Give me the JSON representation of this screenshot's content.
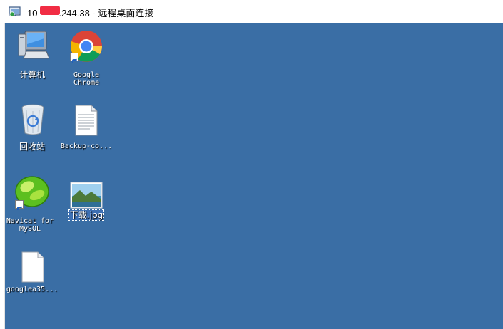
{
  "window": {
    "title_prefix": "10",
    "title_suffix": ".244.38 - 远程桌面连接"
  },
  "desktop": {
    "background": "#3a6ea5",
    "icons": [
      {
        "label": "计算机",
        "icon": "computer-icon"
      },
      {
        "label": "Google\nChrome",
        "icon": "chrome-icon"
      },
      {
        "label": "回收站",
        "icon": "recycle-bin-icon"
      },
      {
        "label": "Backup-co...",
        "icon": "text-file-icon"
      },
      {
        "label": "Navicat for\nMySQL",
        "icon": "navicat-icon"
      },
      {
        "label": "下载.jpg",
        "icon": "image-file-icon"
      },
      {
        "label": "googlea35...",
        "icon": "blank-file-icon"
      }
    ]
  }
}
